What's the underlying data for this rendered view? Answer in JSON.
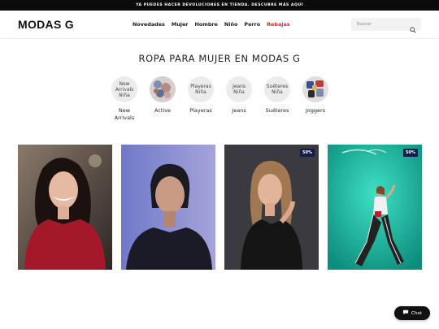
{
  "promo": {
    "text": "YA PUEDES HACER DEVOLUCIONES EN TIENDA. DESCUBRE MÁS AQUÍ"
  },
  "header": {
    "logo": "MODAS G",
    "nav": [
      {
        "label": "Novedades"
      },
      {
        "label": "Mujer"
      },
      {
        "label": "Hombre"
      },
      {
        "label": "Niño"
      },
      {
        "label": "Perro"
      },
      {
        "label": "Rebajas"
      }
    ],
    "search": {
      "placeholder": "Buscar",
      "icon": "search-icon"
    }
  },
  "main": {
    "title": "ROPA PARA MUJER EN MODAS G",
    "categories": [
      {
        "alt": "New Arrivals Niña",
        "label": "New Arrivals"
      },
      {
        "alt": "",
        "label": "Active"
      },
      {
        "alt": "Playeras Niña",
        "label": "Playeras"
      },
      {
        "alt": "Jeans Niña",
        "label": "Jeans"
      },
      {
        "alt": "Suéteres Niña",
        "label": "Suéteres"
      },
      {
        "alt": "",
        "label": "Joggers"
      }
    ],
    "products": [
      {
        "badge": ""
      },
      {
        "badge": ""
      },
      {
        "badge": "50%"
      },
      {
        "badge": "50%"
      }
    ]
  },
  "chat": {
    "label": "Chat",
    "icon": "chat-bubble-icon"
  },
  "colors": {
    "sale": "#e0251b",
    "badge": "#111d4a",
    "promo_bar": "#0b0b0b"
  }
}
